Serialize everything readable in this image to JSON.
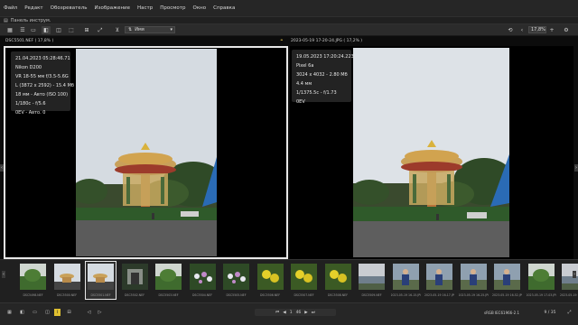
{
  "menu": [
    "Файл",
    "Редакт",
    "Обозреватель",
    "Изображение",
    "Настр",
    "Просмотр",
    "Окно",
    "Справка"
  ],
  "tools_panel": {
    "label": "Панель инструм."
  },
  "toolbar": {
    "sort_label": "Имя",
    "zoom_value": "17,8%",
    "zoom_hint": "+"
  },
  "left_pane": {
    "filename": "DSC5501.NEF ( 17,8% )",
    "info": [
      "21.04.2023 05:28:46.71",
      "Nikon D200",
      "VR 18-55 мм f/3.5-5.6G",
      "L (3872 x 2592) - 15.4 Mб",
      "18 мм - Авто (ISO 100)",
      "1/180с - f/5.6",
      "0EV - Авто. 0"
    ]
  },
  "right_pane": {
    "filename": "2023-05-19 17-20-24.JPG ( 17,2% )",
    "info": [
      "19.05.2023 17:20:24.223",
      "Pixel 6a",
      "3024 x 4032 - 2.80 Mб",
      "4.4 мм",
      "1/1375.5с - f/1.73",
      "0EV"
    ]
  },
  "filmstrip": {
    "items": [
      {
        "caption": "DSC5498.NEF",
        "kind": "green"
      },
      {
        "caption": "DSC5500.NEF",
        "kind": "carousel"
      },
      {
        "caption": "DSC5501.NEF",
        "kind": "carousel",
        "selected": true
      },
      {
        "caption": "DSC5502.NEF",
        "kind": "dark"
      },
      {
        "caption": "DSC5503.NEF",
        "kind": "green"
      },
      {
        "caption": "DSC5504.NEF",
        "kind": "flowers"
      },
      {
        "caption": "DSC5505.NEF",
        "kind": "flowers"
      },
      {
        "caption": "DSC5506.NEF",
        "kind": "yellow"
      },
      {
        "caption": "DSC5507.NEF",
        "kind": "yellow"
      },
      {
        "caption": "DSC5508.NEF",
        "kind": "yellow"
      },
      {
        "caption": "DSC5509.NEF",
        "kind": "water"
      },
      {
        "caption": "2023-05-19 16-15.JPG",
        "kind": "person"
      },
      {
        "caption": "2023-05-19 16-17.JPG",
        "kind": "person"
      },
      {
        "caption": "2023-05-19 16-25.JPG",
        "kind": "person"
      },
      {
        "caption": "2023-05-19 16-52.JPG",
        "kind": "person"
      },
      {
        "caption": "2023-05-19 17-03.JPG",
        "kind": "green"
      },
      {
        "caption": "2023-05-19 17-08.JPG",
        "kind": "water"
      }
    ]
  },
  "status": {
    "page_total": "1",
    "page_count": "46",
    "color_profile": "sRGB IEC61966-2.1",
    "counter": "9 / 35"
  },
  "colors": {
    "selection_border": "#e8e8e8",
    "sky": "#d7dde3",
    "accent": "#4a8fd6"
  }
}
